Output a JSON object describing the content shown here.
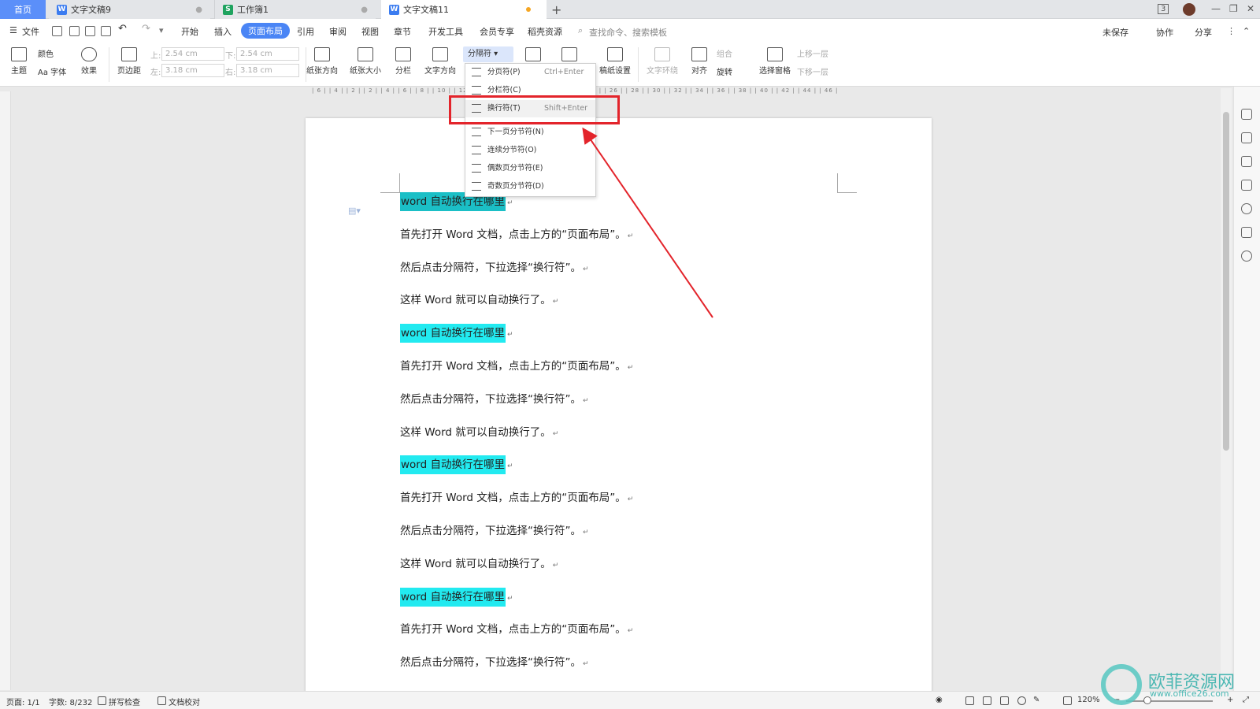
{
  "tabs": {
    "home": "首页",
    "doc1": "文字文稿9",
    "sheet1": "工作簿1",
    "doc2": "文字文稿11",
    "new_tab": "+"
  },
  "window_controls": {
    "count": "3"
  },
  "menubar": {
    "file": "文件",
    "items": [
      "开始",
      "插入",
      "页面布局",
      "引用",
      "审阅",
      "视图",
      "章节",
      "开发工具",
      "会员专享",
      "稻壳资源"
    ],
    "active": "页面布局",
    "search_placeholder": "查找命令、搜索模板",
    "unsaved": "未保存",
    "collab": "协作",
    "share": "分享"
  },
  "ribbon": {
    "theme": "主题",
    "color": "颜色",
    "font": "Aa 字体",
    "effect": "效果",
    "margin": "页边距",
    "top_label": "上:",
    "top_value": "2.54 cm",
    "bottom_label": "下:",
    "bottom_value": "2.54 cm",
    "left_label": "左:",
    "left_value": "3.18 cm",
    "right_label": "右:",
    "right_value": "3.18 cm",
    "orientation": "纸张方向",
    "size": "纸张大小",
    "columns": "分栏",
    "text_dir": "文字方向",
    "separator": "分隔符",
    "manuscript": "稿纸设置",
    "wrap": "文字环绕",
    "align": "对齐",
    "rotate": "旋转",
    "select_pane": "选择窗格",
    "group": "组合",
    "bring_forward": "上移一层",
    "send_backward": "下移一层"
  },
  "ruler_text": "| 6 | | 4 | | 2 | | 2 | | 4 | | 6 | | 8 | | 10 | | 12 | | 14 | | 16 | | 18 | | 20 | | 22 | | 24 | | 26 | | 28 | | 30 | | 32 | | 34 | | 36 | | 38 | | 40 | | 42 | | 44 | | 46 |",
  "dropdown": [
    {
      "label": "分页符(P)",
      "shortcut": "Ctrl+Enter"
    },
    {
      "label": "分栏符(C)",
      "shortcut": ""
    },
    {
      "label": "换行符(T)",
      "shortcut": "Shift+Enter"
    },
    {
      "label": "下一页分节符(N)",
      "shortcut": ""
    },
    {
      "label": "连续分节符(O)",
      "shortcut": ""
    },
    {
      "label": "偶数页分节符(E)",
      "shortcut": ""
    },
    {
      "label": "奇数页分节符(D)",
      "shortcut": ""
    }
  ],
  "document": {
    "heading": "word 自动换行在哪里",
    "p1": "首先打开 Word 文档，点击上方的“页面布局”。",
    "p2": "然后点击分隔符，下拉选择“换行符”。",
    "p3": "这样 Word 就可以自动换行了。",
    "para_mark": "↵"
  },
  "status": {
    "page": "页面: 1/1",
    "words": "字数: 8/232",
    "spell": "拼写检查",
    "proof": "文档校对",
    "zoom": "120%"
  },
  "watermark": {
    "title": "欧菲资源网",
    "url": "www.office26.com"
  },
  "colors": {
    "accent": "#4a85f5",
    "highlight": "#22eaf0",
    "highlight_selected": "#1bbfc6",
    "annotation_red": "#e3242b"
  }
}
